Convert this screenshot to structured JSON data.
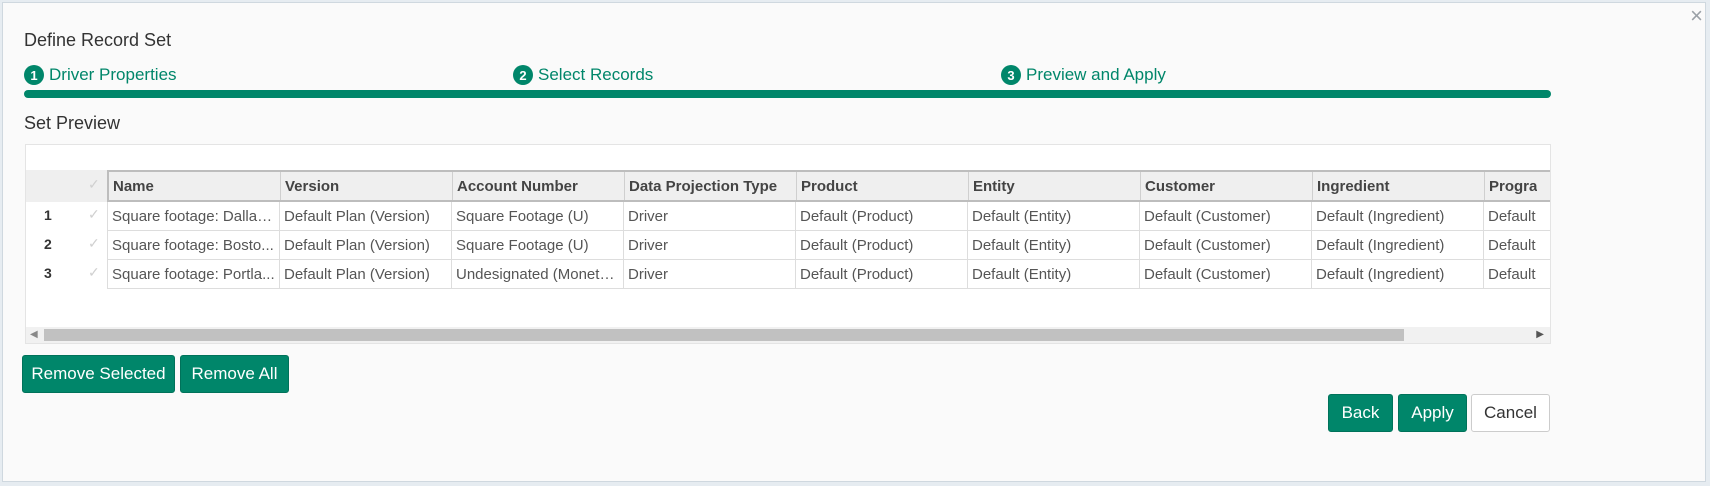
{
  "dialog": {
    "title": "Define Record Set",
    "close_icon": "×",
    "steps": [
      {
        "number": "1",
        "label": "Driver Properties"
      },
      {
        "number": "2",
        "label": "Select Records"
      },
      {
        "number": "3",
        "label": "Preview and Apply"
      }
    ],
    "progress_fraction": 1.0,
    "section_title": "Set Preview"
  },
  "grid": {
    "columns": [
      "Name",
      "Version",
      "Account Number",
      "Data Projection Type",
      "Product",
      "Entity",
      "Customer",
      "Ingredient",
      "Progra"
    ],
    "rows": [
      {
        "num": "1",
        "cells": [
          "Square footage: Dallas ...",
          "Default Plan (Version)",
          "Square Footage (U)",
          "Driver",
          "Default (Product)",
          "Default (Entity)",
          "Default (Customer)",
          "Default (Ingredient)",
          "Default"
        ]
      },
      {
        "num": "2",
        "cells": [
          "Square footage: Bosto...",
          "Default Plan (Version)",
          "Square Footage (U)",
          "Driver",
          "Default (Product)",
          "Default (Entity)",
          "Default (Customer)",
          "Default (Ingredient)",
          "Default"
        ]
      },
      {
        "num": "3",
        "cells": [
          "Square footage: Portla...",
          "Default Plan (Version)",
          "Undesignated (Moneta...",
          "Driver",
          "Default (Product)",
          "Default (Entity)",
          "Default (Customer)",
          "Default (Ingredient)",
          "Default"
        ]
      }
    ]
  },
  "buttons": {
    "remove_selected": "Remove Selected",
    "remove_all": "Remove All",
    "back": "Back",
    "apply": "Apply",
    "cancel": "Cancel"
  },
  "colors": {
    "accent": "#00866a"
  }
}
